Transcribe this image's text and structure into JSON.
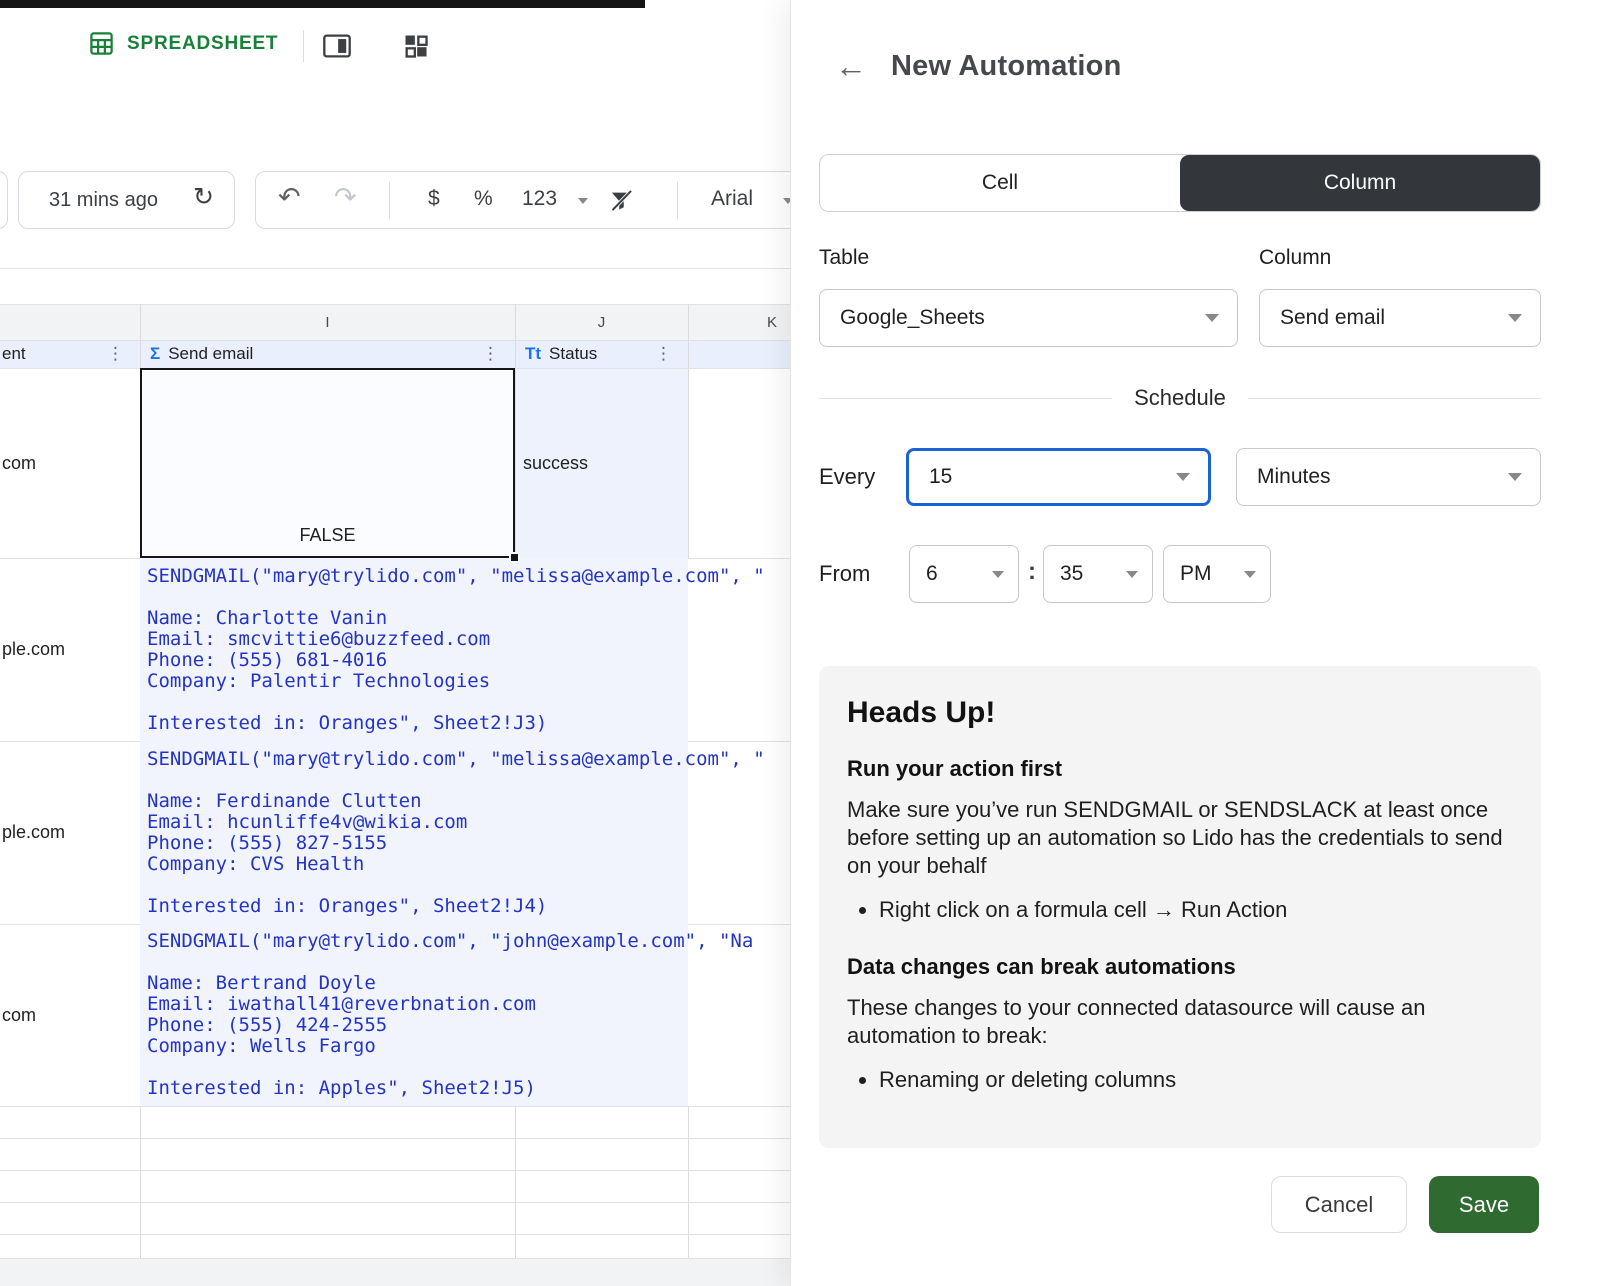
{
  "icons": {
    "refresh": "↻",
    "undo": "↶",
    "redo": "↷",
    "back": "←",
    "kebab": "⋮",
    "sigma": "Σ",
    "text_format": "Tt"
  },
  "topbar": {
    "app_label": "SPREADSHEET"
  },
  "toolbar": {
    "last_sync": "31 mins ago",
    "currency_label": "$",
    "percent_label": "%",
    "number_format_label": "123",
    "font_name": "Arial"
  },
  "sheet": {
    "col_letters": {
      "i": "I",
      "j": "J",
      "k": "K"
    },
    "headers": {
      "left_partial": "ent",
      "send_email": "Send email",
      "status": "Status"
    },
    "rows": {
      "r1": {
        "left": "com",
        "value": "FALSE",
        "status": "success"
      },
      "r2": {
        "left": "ple.com",
        "formula": "SENDGMAIL(\"mary@trylido.com\", \"melissa@example.com\", \"\n\nName: Charlotte Vanin\nEmail: smcvittie6@buzzfeed.com\nPhone: (555) 681-4016\nCompany: Palentir Technologies\n\nInterested in: Oranges\", Sheet2!J3)"
      },
      "r3": {
        "left": "ple.com",
        "formula": "SENDGMAIL(\"mary@trylido.com\", \"melissa@example.com\", \"\n\nName: Ferdinande Clutten\nEmail: hcunliffe4v@wikia.com\nPhone: (555) 827-5155\nCompany: CVS Health\n\nInterested in: Oranges\", Sheet2!J4)"
      },
      "r4": {
        "left": "com",
        "formula": "SENDGMAIL(\"mary@trylido.com\", \"john@example.com\", \"Na\n\nName: Bertrand Doyle\nEmail: iwathall41@reverbnation.com\nPhone: (555) 424-2555\nCompany: Wells Fargo\n\nInterested in: Apples\", Sheet2!J5)"
      }
    }
  },
  "panel": {
    "title": "New Automation",
    "tabs": {
      "cell": "Cell",
      "column": "Column"
    },
    "table_label": "Table",
    "table_value": "Google_Sheets",
    "column_label": "Column",
    "column_value": "Send email",
    "schedule_label": "Schedule",
    "every_label": "Every",
    "every_value": "15",
    "every_unit": "Minutes",
    "from_label": "From",
    "from_hour": "6",
    "time_separator": ":",
    "from_minute": "35",
    "from_ampm": "PM",
    "heads_up": {
      "title": "Heads Up!",
      "section1_title": "Run your action first",
      "section1_body": "Make sure you’ve run SENDGMAIL or SENDSLACK at least once before setting up an automation so Lido has the credentials to send on your behalf",
      "section1_bullet": "Right click on a formula cell → Run Action",
      "section2_title": "Data changes can break automations",
      "section2_body": "These changes to your connected datasource will cause an automation to break:",
      "section2_bullet": "Renaming or deleting columns"
    },
    "cancel_label": "Cancel",
    "save_label": "Save"
  }
}
